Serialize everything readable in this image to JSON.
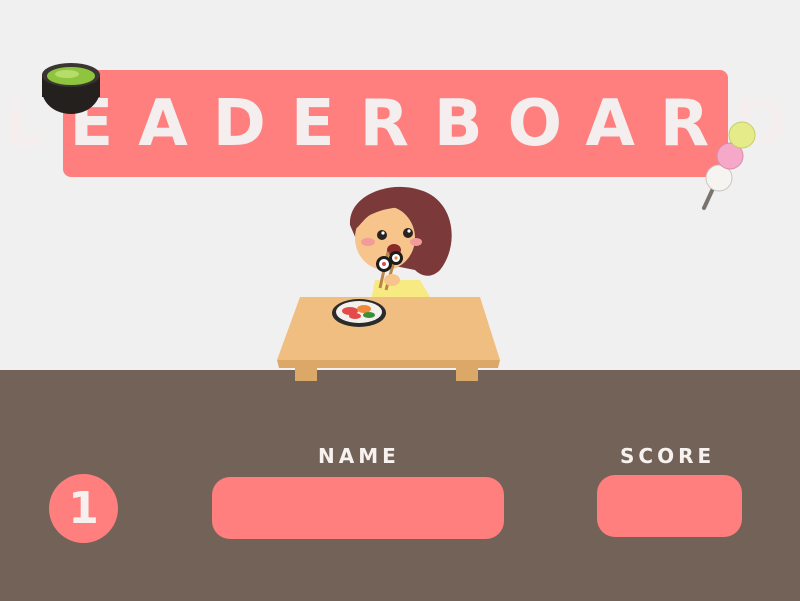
{
  "banner": {
    "title": "LEADERBOARD"
  },
  "columns": {
    "name_label": "NAME",
    "score_label": "SCORE"
  },
  "entry": {
    "rank": "1",
    "name": "",
    "score": ""
  },
  "icons": {
    "tea": "matcha-bowl-icon",
    "dango": "dango-skewer-icon"
  },
  "colors": {
    "accent": "#ff7f7f",
    "floor": "#726257",
    "background": "#f1f0f1",
    "table": "#efbe80"
  }
}
